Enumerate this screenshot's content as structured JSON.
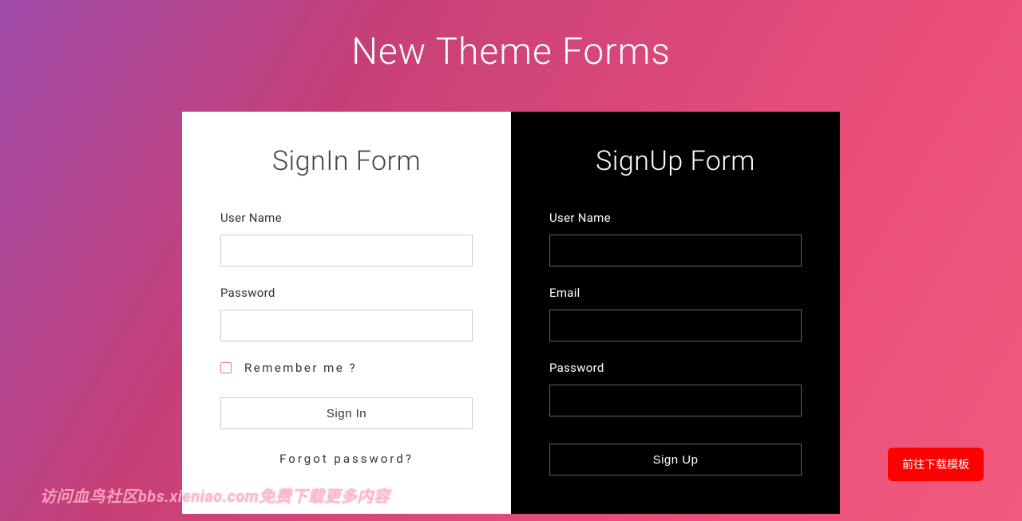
{
  "page_title": "New Theme Forms",
  "signin": {
    "title": "SignIn Form",
    "username_label": "User Name",
    "password_label": "Password",
    "remember_label": "Remember me ?",
    "submit_label": "Sign In",
    "forgot_label": "Forgot password?"
  },
  "signup": {
    "title": "SignUp Form",
    "username_label": "User Name",
    "email_label": "Email",
    "password_label": "Password",
    "submit_label": "Sign Up"
  },
  "download_button": "前往下载模板",
  "watermark": "访问血鸟社区bbs.xieniao.com免费下载更多内容"
}
